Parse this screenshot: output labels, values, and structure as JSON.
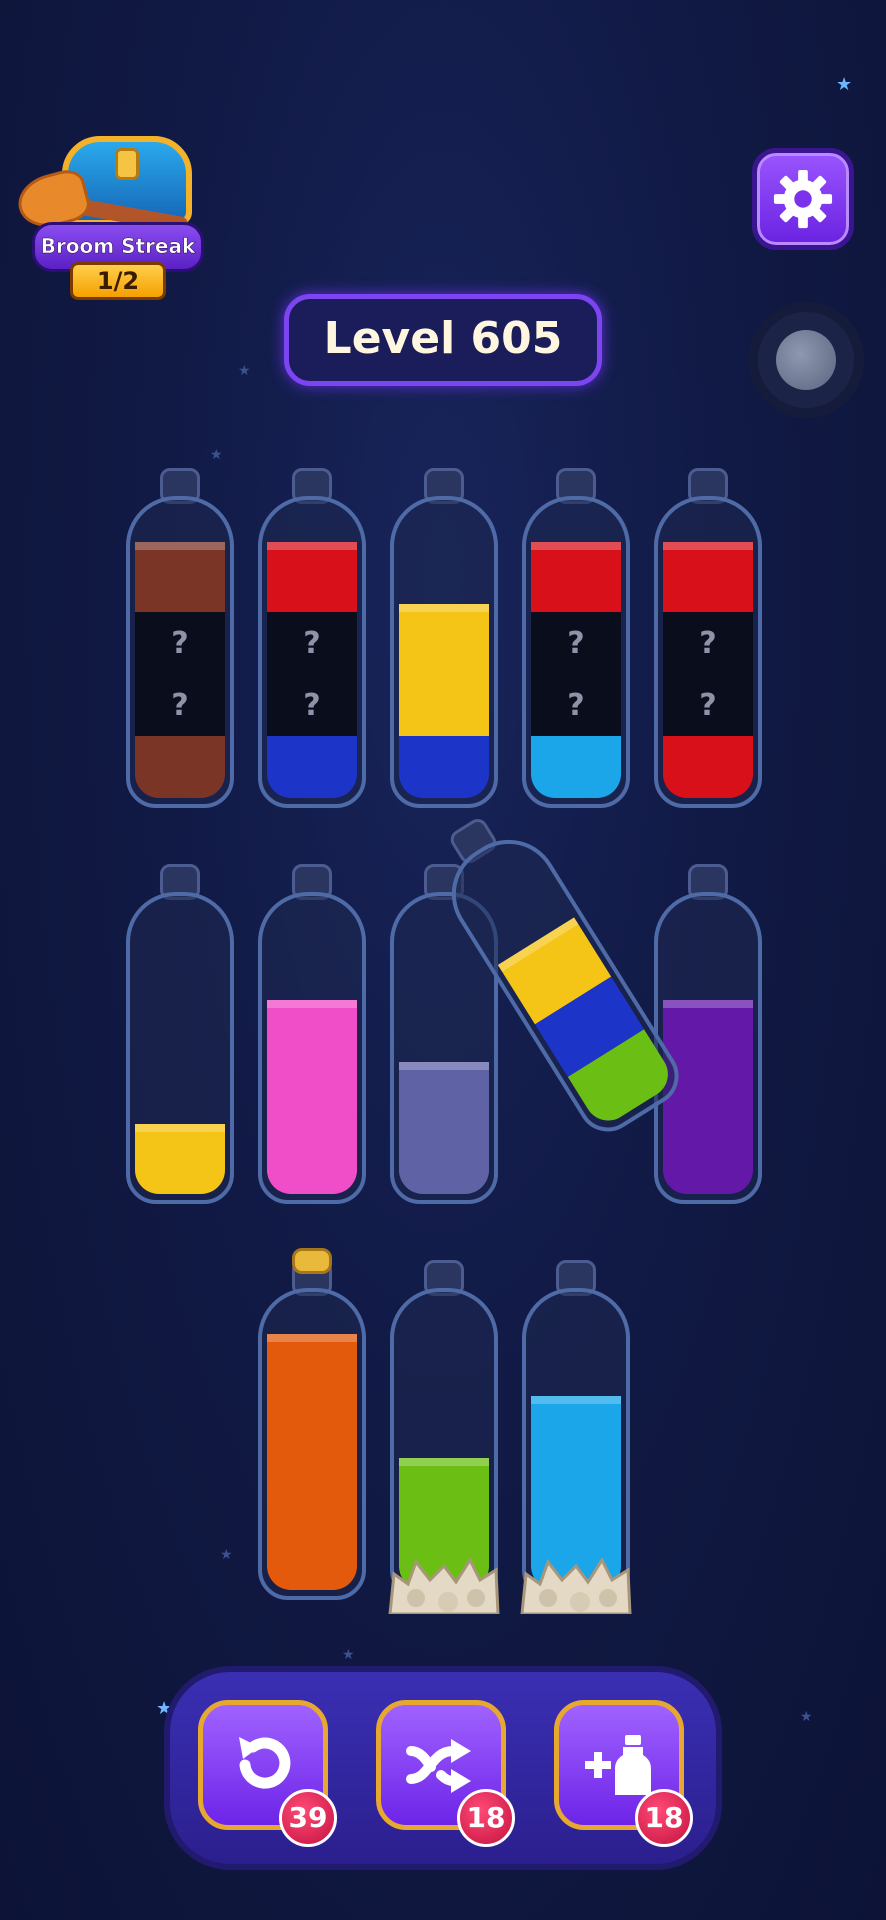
{
  "streak": {
    "title": "Broom Streak",
    "progress": "1/2"
  },
  "level": {
    "label": "Level 605"
  },
  "colors": {
    "brown": "#7a3526",
    "red": "#d8101a",
    "blue": "#1c34c8",
    "yellow": "#f4c417",
    "cyan": "#1aa6e8",
    "pink": "#f04dc8",
    "lavender": "#6062a6",
    "purple": "#6318a8",
    "green": "#6bbf14",
    "orange": "#e35a0c",
    "hidden": "#0a0d1c"
  },
  "bottles_row1": [
    {
      "segments": [
        "brown",
        "hidden",
        "hidden",
        "brown"
      ]
    },
    {
      "segments": [
        "red",
        "hidden",
        "hidden",
        "blue"
      ]
    },
    {
      "segments": [
        "yellow",
        "yellow",
        "blue"
      ]
    },
    {
      "segments": [
        "red",
        "hidden",
        "hidden",
        "cyan"
      ]
    },
    {
      "segments": [
        "red",
        "hidden",
        "hidden",
        "red"
      ]
    }
  ],
  "bottles_row2": [
    {
      "segments": [
        "yellow"
      ]
    },
    {
      "segments": [
        "pink",
        "pink",
        "pink"
      ]
    },
    {
      "segments": [
        "lavender",
        "lavender"
      ]
    },
    {
      "segments": [
        "yellow",
        "blue",
        "green"
      ],
      "tilted": true
    },
    {
      "segments": [
        "purple",
        "purple",
        "purple"
      ]
    }
  ],
  "bottles_row3": [
    {
      "segments": [
        "orange",
        "orange",
        "orange",
        "orange"
      ],
      "corked": true
    },
    {
      "segments": [
        "green",
        "green"
      ],
      "rocks": true
    },
    {
      "segments": [
        "cyan",
        "cyan",
        "cyan"
      ],
      "rocks": true
    }
  ],
  "hidden_mark": "?",
  "powerups": {
    "undo": {
      "icon": "undo-icon",
      "count": "39"
    },
    "shuffle": {
      "icon": "shuffle-icon",
      "count": "18"
    },
    "add_bottle": {
      "icon": "add-bottle-icon",
      "count": "18"
    }
  }
}
